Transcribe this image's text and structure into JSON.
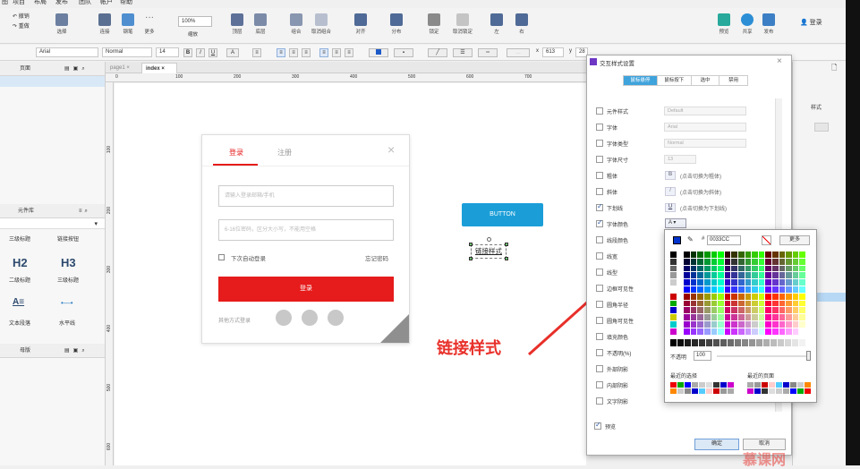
{
  "menu": {
    "items": [
      "图",
      "项目",
      "布局",
      "发布",
      "团队",
      "帐户",
      "帮助"
    ]
  },
  "toolbar": {
    "undo": "撤销",
    "redo": "重做",
    "select": "选择",
    "connect": "连接",
    "pen": "钢笔",
    "more": "更多",
    "zoom_value": "100%",
    "zoom_label": "缩放",
    "top": "顶层",
    "bottom": "底层",
    "group": "组合",
    "ungroup": "取消组合",
    "align": "对齐",
    "distribute": "分布",
    "lock": "锁定",
    "unlock": "取消锁定",
    "left": "左",
    "right": "右",
    "preview": "预览",
    "share": "共享",
    "publish": "发布",
    "login": "登录"
  },
  "format": {
    "font": "Arial",
    "style": "Normal",
    "size": "14",
    "x": "613",
    "y": "28"
  },
  "pages_panel": {
    "title": "页面"
  },
  "library_panel": {
    "title": "元件库",
    "items": [
      {
        "glyph": "",
        "label": "三级标题"
      },
      {
        "glyph": "",
        "label": "链接按钮"
      },
      {
        "glyph": "H2",
        "label": "二级标题"
      },
      {
        "glyph": "H3",
        "label": "三级标题"
      },
      {
        "glyph": "A≡",
        "label": "文本段落"
      },
      {
        "glyph": "•—•",
        "label": "水平线"
      }
    ]
  },
  "masters_panel": {
    "title": "母版"
  },
  "tabs": {
    "page1": "page1",
    "index": "index"
  },
  "ruler": {
    "h": [
      "0",
      "100",
      "200",
      "300",
      "400",
      "500",
      "600",
      "700"
    ],
    "v": [
      "100",
      "200",
      "300",
      "400",
      "500",
      "600"
    ]
  },
  "login_form": {
    "tab_login": "登录",
    "tab_register": "注册",
    "email_placeholder": "请输入登录邮箱/手机",
    "password_placeholder": "6-16位密码，区分大小写，不能用空格",
    "auto_login": "下次自动登录",
    "forgot": "忘记密码",
    "submit": "登录",
    "other_login": "其他方式登录"
  },
  "canvas": {
    "button_label": "BUTTON",
    "link_text": "链接样式"
  },
  "annotation": {
    "text": "链接样式",
    "color": "#e8302a"
  },
  "dialog": {
    "title": "交互样式设置",
    "tabs": [
      "鼠标悬停",
      "鼠标按下",
      "选中",
      "禁用"
    ],
    "rows": [
      {
        "label": "元件样式",
        "checked": false,
        "value": "Default",
        "hint": ""
      },
      {
        "label": "字体",
        "checked": false,
        "value": "Arial",
        "hint": ""
      },
      {
        "label": "字体类型",
        "checked": false,
        "value": "Normal",
        "hint": ""
      },
      {
        "label": "字体尺寸",
        "checked": false,
        "value": "13",
        "hint": ""
      },
      {
        "label": "粗体",
        "checked": false,
        "value": "",
        "hint": "(点击切换为粗体)"
      },
      {
        "label": "斜体",
        "checked": false,
        "value": "",
        "hint": "(点击切换为斜体)"
      },
      {
        "label": "下划线",
        "checked": true,
        "value": "",
        "hint": "(点击切换为下划线)"
      },
      {
        "label": "字体颜色",
        "checked": true,
        "value": "",
        "hint": ""
      },
      {
        "label": "线段颜色",
        "checked": false,
        "value": "",
        "hint": ""
      },
      {
        "label": "线宽",
        "checked": false,
        "value": "",
        "hint": ""
      },
      {
        "label": "线型",
        "checked": false,
        "value": "",
        "hint": ""
      },
      {
        "label": "边框可见性",
        "checked": false,
        "value": "",
        "hint": ""
      },
      {
        "label": "圆角半径",
        "checked": false,
        "value": "",
        "hint": ""
      },
      {
        "label": "圆角可见性",
        "checked": false,
        "value": "",
        "hint": ""
      },
      {
        "label": "填充颜色",
        "checked": false,
        "value": "",
        "hint": ""
      },
      {
        "label": "不透明(%)",
        "checked": false,
        "value": "",
        "hint": ""
      },
      {
        "label": "外部阴影",
        "checked": false,
        "value": "",
        "hint": ""
      },
      {
        "label": "内部阴影",
        "checked": false,
        "value": "",
        "hint": ""
      },
      {
        "label": "文字阴影",
        "checked": false,
        "value": "",
        "hint": ""
      }
    ],
    "preview": "预览",
    "ok": "确定",
    "cancel": "取消"
  },
  "picker": {
    "hex_prefix": "#",
    "hex": "0033CC",
    "more": "更多",
    "opacity_label": "不透明",
    "opacity": "100",
    "recent": "最近的选择",
    "recent_page": "最近的页面",
    "current_color": "#0033cc"
  },
  "right_panel": {
    "title": "样式"
  },
  "watermark": {
    "text": "慕课网"
  },
  "colors": {
    "accent": "#3fa3dc",
    "red": "#e61b1b",
    "button": "#1b9ed8"
  }
}
